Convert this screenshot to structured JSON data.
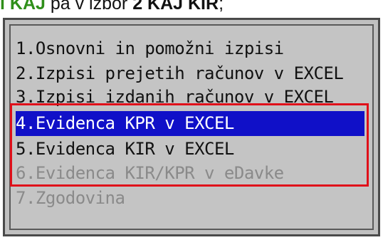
{
  "caption": {
    "part1": "i KAJ",
    "part2": " pa v izbor ",
    "part3": "2 KAJ KIR",
    "part4": ";"
  },
  "menu": {
    "items": [
      {
        "label": "1.Osnovni in pomožni izpisi",
        "state": "normal"
      },
      {
        "label": "2.Izpisi prejetih računov v EXCEL",
        "state": "normal"
      },
      {
        "label": "3.Izpisi izdanih računov v EXCEL",
        "state": "normal"
      },
      {
        "label": "4.Evidenca KPR v EXCEL",
        "state": "selected"
      },
      {
        "label": "5.Evidenca KIR v EXCEL",
        "state": "normal"
      },
      {
        "label": "6.Evidenca KIR/KPR v eDavke",
        "state": "disabled"
      },
      {
        "label": "7.Zgodovina",
        "state": "disabled"
      }
    ]
  },
  "colors": {
    "selection": "#1010c8",
    "highlight_border": "#e0101a",
    "disabled_text": "#8a8a8a",
    "caption_green": "#2f8f1a"
  }
}
